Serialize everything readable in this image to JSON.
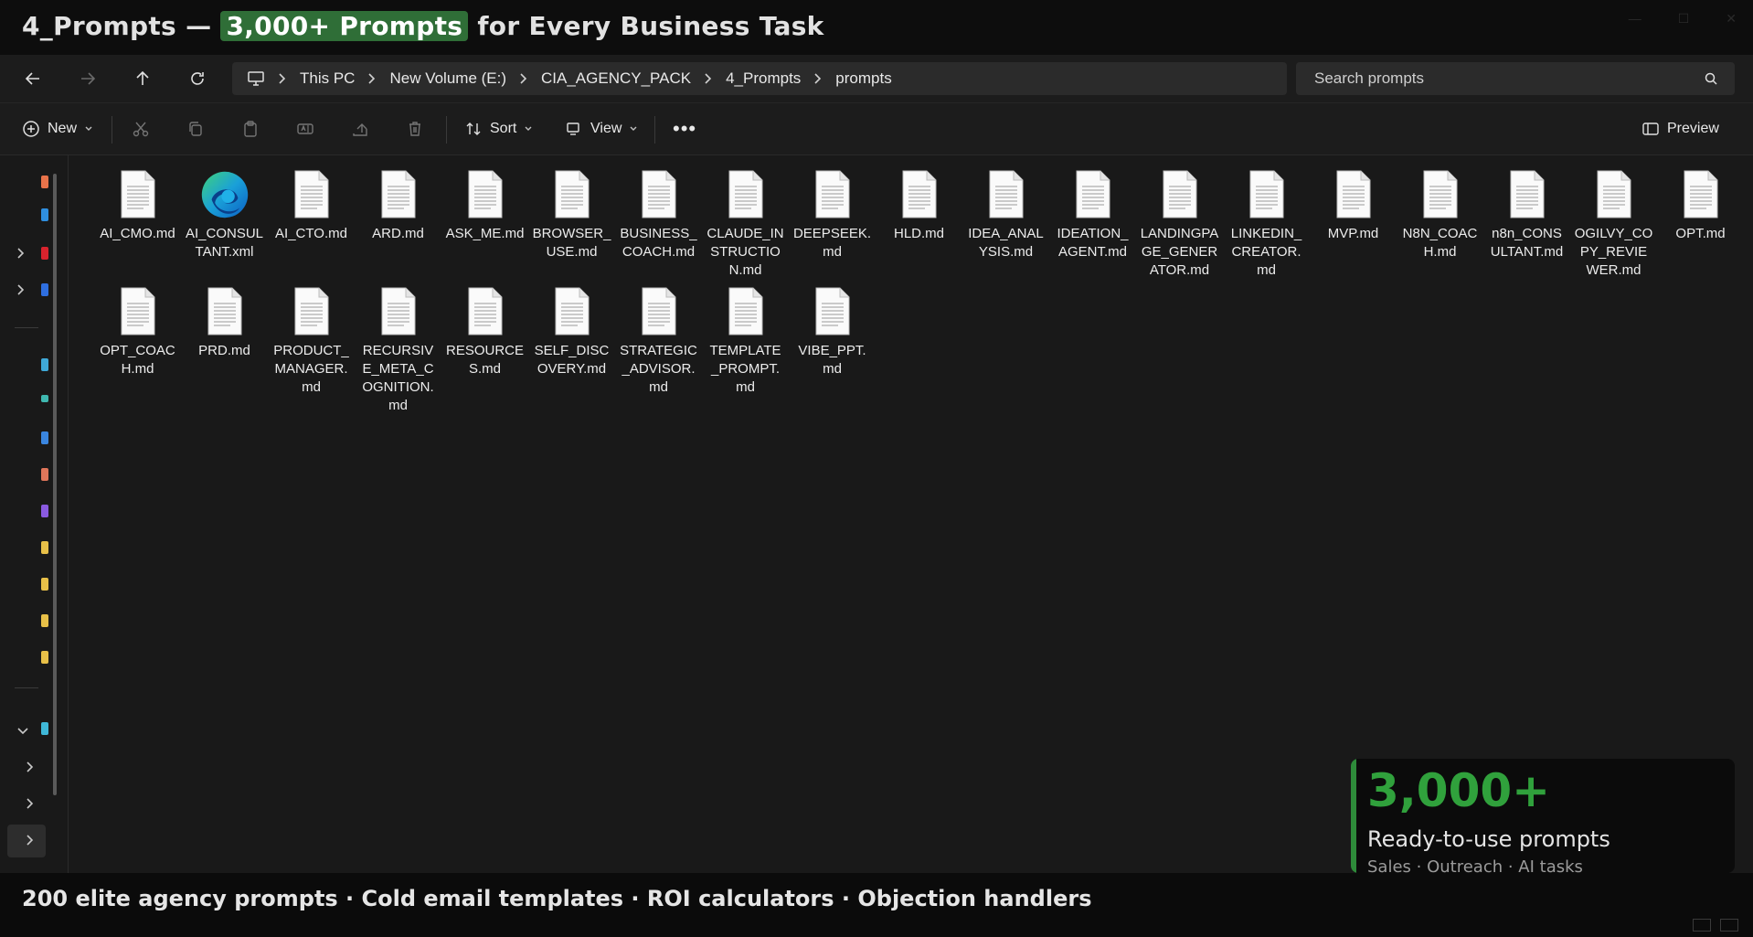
{
  "window": {
    "title_prefix": "4_Prompts —",
    "title_highlight": "3,000+ Prompts",
    "title_suffix": "for Every Business Task"
  },
  "nav": {
    "breadcrumbs": [
      "This PC",
      "New Volume (E:)",
      "CIA_AGENCY_PACK",
      "4_Prompts",
      "prompts"
    ],
    "search_placeholder": "Search prompts"
  },
  "toolbar": {
    "new_label": "New",
    "sort_label": "Sort",
    "view_label": "View",
    "preview_label": "Preview"
  },
  "files": [
    {
      "name": "AI_CMO.md",
      "icon": "document-icon"
    },
    {
      "name": "AI_CONSULTANT.xml",
      "icon": "edge-icon"
    },
    {
      "name": "AI_CTO.md",
      "icon": "document-icon"
    },
    {
      "name": "ARD.md",
      "icon": "document-icon"
    },
    {
      "name": "ASK_ME.md",
      "icon": "document-icon"
    },
    {
      "name": "BROWSER_USE.md",
      "icon": "document-icon"
    },
    {
      "name": "BUSINESS_COACH.md",
      "icon": "document-icon"
    },
    {
      "name": "CLAUDE_INSTRUCTION.md",
      "icon": "document-icon"
    },
    {
      "name": "DEEPSEEK.md",
      "icon": "document-icon"
    },
    {
      "name": "HLD.md",
      "icon": "document-icon"
    },
    {
      "name": "IDEA_ANALYSIS.md",
      "icon": "document-icon"
    },
    {
      "name": "IDEATION_AGENT.md",
      "icon": "document-icon"
    },
    {
      "name": "LANDINGPAGE_GENERATOR.md",
      "icon": "document-icon"
    },
    {
      "name": "LINKEDIN_CREATOR.md",
      "icon": "document-icon"
    },
    {
      "name": "MVP.md",
      "icon": "document-icon"
    },
    {
      "name": "N8N_COACH.md",
      "icon": "document-icon"
    },
    {
      "name": "n8n_CONSULTANT.md",
      "icon": "document-icon"
    },
    {
      "name": "OGILVY_COPY_REVIEWER.md",
      "icon": "document-icon"
    },
    {
      "name": "OPT.md",
      "icon": "document-icon"
    },
    {
      "name": "OPT_COACH.md",
      "icon": "document-icon"
    },
    {
      "name": "PRD.md",
      "icon": "document-icon"
    },
    {
      "name": "PRODUCT_MANAGER.md",
      "icon": "document-icon"
    },
    {
      "name": "RECURSIVE_META_COGNITION.md",
      "icon": "document-icon"
    },
    {
      "name": "RESOURCES.md",
      "icon": "document-icon"
    },
    {
      "name": "SELF_DISCOVERY.md",
      "icon": "document-icon"
    },
    {
      "name": "STRATEGIC_ADVISOR.md",
      "icon": "document-icon"
    },
    {
      "name": "TEMPLATE_PROMPT.md",
      "icon": "document-icon"
    },
    {
      "name": "VIBE_PPT.md",
      "icon": "document-icon"
    }
  ],
  "promo": {
    "big": "3,000+",
    "sub": "Ready-to-use prompts",
    "tags": "Sales · Outreach · AI tasks"
  },
  "caption": "200 elite agency prompts · Cold email templates · ROI calculators · Objection handlers",
  "colors": {
    "accent": "#30a13c",
    "highlight": "#2f6e37",
    "background": "#191919"
  }
}
